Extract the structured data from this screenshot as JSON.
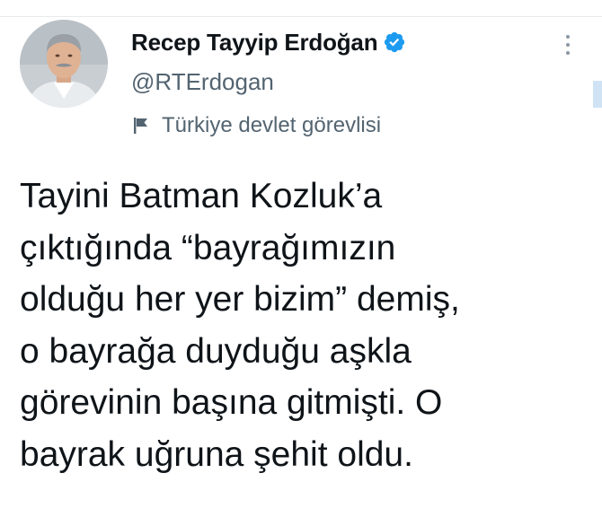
{
  "tweet": {
    "author": {
      "display_name": "Recep Tayyip Erdoğan",
      "handle": "@RTErdogan",
      "verified": true,
      "verified_icon": "verified-badge-icon",
      "avatar_icon": "profile-photo"
    },
    "label": {
      "icon": "flag-icon",
      "text": "Türkiye devlet görevlisi"
    },
    "more_icon": "more-options-icon",
    "text_lines": [
      "Tayini Batman Kozluk’a",
      "çıktığında “bayrağımızın",
      "olduğu her yer bizim” demiş,",
      "o bayrağa duyduğu aşkla",
      "görevinin başına gitmişti. O",
      "bayrak uğruna şehit oldu."
    ]
  },
  "colors": {
    "text_primary": "#0f1419",
    "text_secondary": "#536471",
    "verified_blue": "#1d9bf0",
    "divider": "#e7e9ea"
  }
}
